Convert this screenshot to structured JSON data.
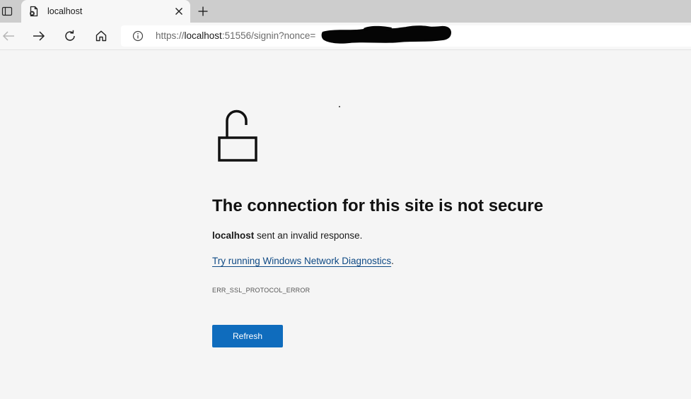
{
  "tab": {
    "title": "localhost"
  },
  "omnibox": {
    "url_prefix": "https://",
    "url_host": "localhost",
    "url_rest": ":51556/signin?nonce="
  },
  "error": {
    "heading": "The connection for this site is not secure",
    "host": "localhost",
    "message": " sent an invalid response.",
    "diagnostics_link": "Try running Windows Network Diagnostics",
    "diagnostics_suffix": ".",
    "code": "ERR_SSL_PROTOCOL_ERROR",
    "refresh_label": "Refresh"
  },
  "colors": {
    "accent": "#0f6cbd",
    "link": "#0f4a85",
    "tabstrip": "#cdcdcd",
    "background": "#f5f5f5"
  },
  "icons": {
    "tab_actions": "tab-actions-icon",
    "favicon": "page-error-icon",
    "close": "close-icon",
    "new_tab": "plus-icon",
    "back": "arrow-left-icon",
    "forward": "arrow-right-icon",
    "refresh": "refresh-icon",
    "home": "home-icon",
    "site_info": "info-icon",
    "lock": "unlocked-padlock-icon"
  }
}
